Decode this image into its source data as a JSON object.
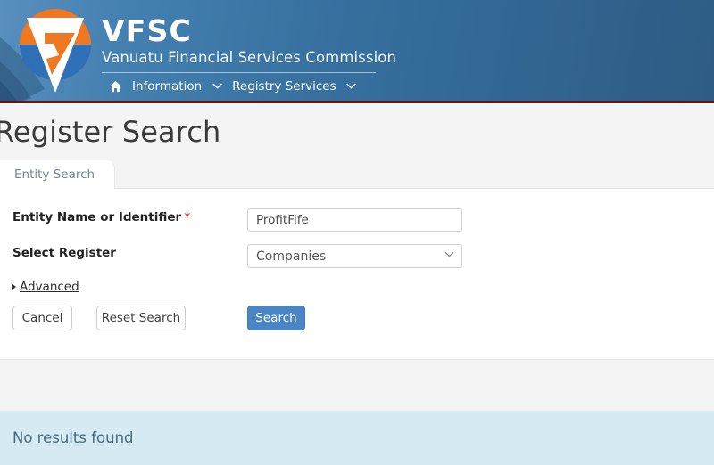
{
  "header": {
    "logo_icon": "vfsc-shield-logo",
    "acronym": "VFSC",
    "full_name": "Vanuatu Financial Services Commission",
    "accent_blue": "#366f9e",
    "accent_orange": "#ef7922",
    "border_maroon": "#5e1515",
    "nav": {
      "home_icon": "home-icon",
      "items": [
        {
          "label": "Information",
          "caret_icon": "chevron-down-icon"
        },
        {
          "label": "Registry Services",
          "caret_icon": "chevron-down-icon"
        }
      ]
    }
  },
  "page": {
    "title": "Register Search"
  },
  "tabs": [
    {
      "label": "Entity Search",
      "active": true
    }
  ],
  "form": {
    "entity_name": {
      "label": "Entity Name or Identifier",
      "required_marker": "*",
      "value": "ProfitFife",
      "placeholder": ""
    },
    "select_register": {
      "label": "Select Register",
      "value": "Companies",
      "caret_icon": "chevron-down-icon"
    },
    "advanced": {
      "label": "Advanced",
      "toggle_icon": "triangle-right-icon"
    },
    "buttons": {
      "cancel": "Cancel",
      "reset": "Reset Search",
      "search": "Search",
      "search_color": "#4a86c5"
    }
  },
  "results": {
    "message": "No results found",
    "banner_color": "#d6eaf4"
  }
}
